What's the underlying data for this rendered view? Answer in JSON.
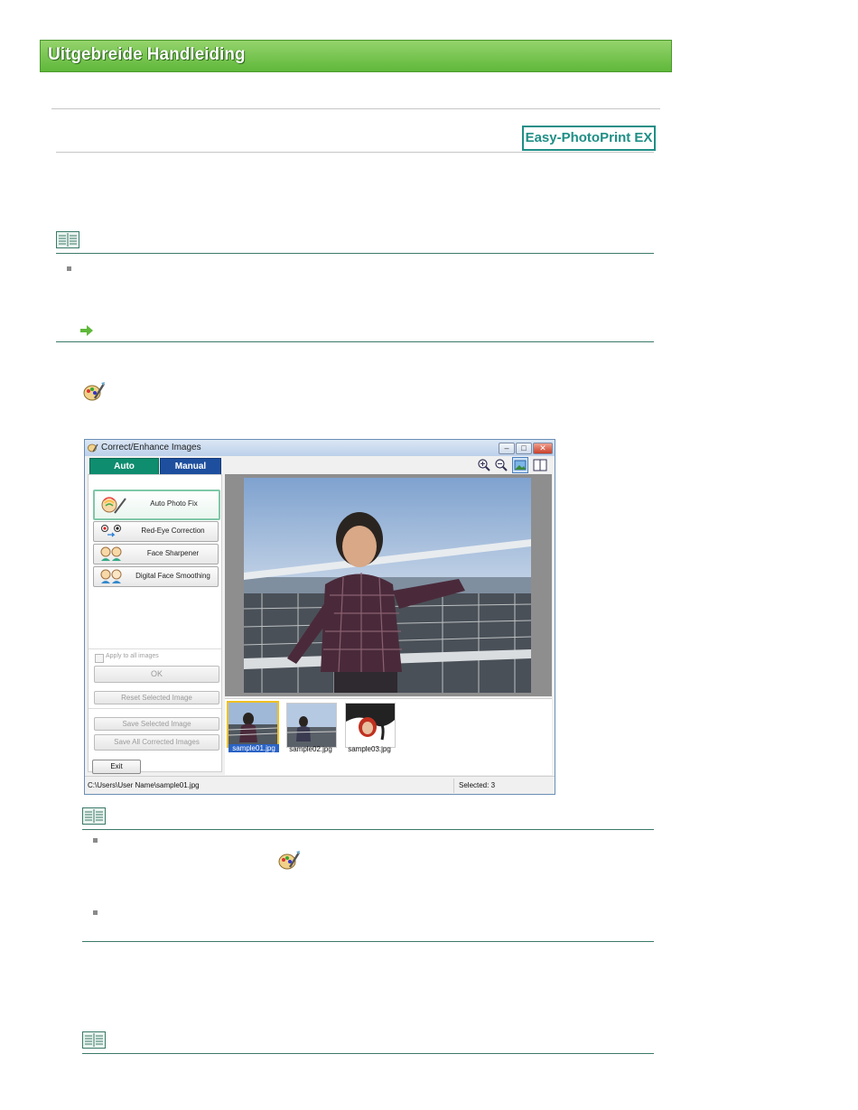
{
  "banner": {
    "title": "Uitgebreide Handleiding"
  },
  "badge": {
    "label": "Easy-PhotoPrint EX"
  },
  "window": {
    "title": "Correct/Enhance Images",
    "controls": {
      "minimize": "–",
      "maximize": "□",
      "close": "✕"
    },
    "tabs": [
      {
        "label": "Auto"
      },
      {
        "label": "Manual"
      }
    ],
    "fix_buttons": [
      {
        "label": "Auto Photo Fix"
      },
      {
        "label": "Red-Eye Correction"
      },
      {
        "label": "Face Sharpener"
      },
      {
        "label": "Digital Face Smoothing"
      }
    ],
    "apply_all_label": "Apply to all images",
    "ok_label": "OK",
    "reset_label": "Reset Selected Image",
    "save_selected_label": "Save Selected Image",
    "save_all_label": "Save All Corrected Images",
    "exit_label": "Exit",
    "thumbnails": [
      {
        "label": "sample01.jpg"
      },
      {
        "label": "sample02.jpg"
      },
      {
        "label": "sample03.jpg"
      }
    ],
    "status": {
      "path": "C:\\Users\\User Name\\sample01.jpg",
      "selected": "Selected: 3"
    }
  },
  "colors": {
    "banner_green": "#5fb83a",
    "badge_teal": "#1f8f86",
    "tab_auto": "#0e8d6f",
    "tab_manual": "#1d4f9e"
  }
}
